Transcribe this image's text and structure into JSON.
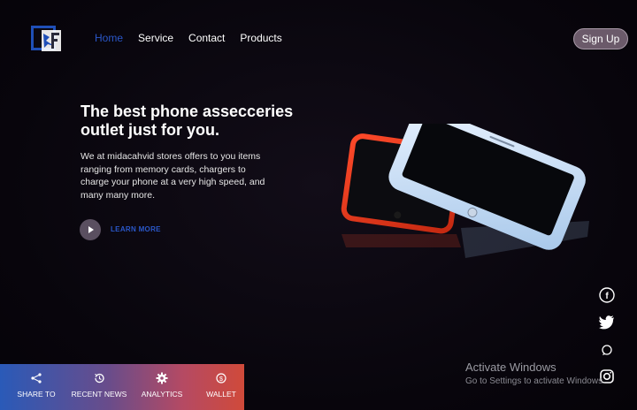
{
  "nav": {
    "items": [
      {
        "label": "Home",
        "active": true
      },
      {
        "label": "Service",
        "active": false
      },
      {
        "label": "Contact",
        "active": false
      },
      {
        "label": "Products",
        "active": false
      }
    ],
    "signup_label": "Sign Up"
  },
  "hero": {
    "title": "The best phone assecceries outlet just for you.",
    "description": "We at midacahvid stores offers to you items ranging from memory cards, chargers to charge your phone at a very high speed, and many many more.",
    "cta_label": "LEARN MORE"
  },
  "social": [
    "facebook-icon",
    "twitter-icon",
    "whatsapp-icon",
    "instagram-icon"
  ],
  "bottom_bar": {
    "items": [
      {
        "label": "SHARE TO",
        "icon": "share-icon"
      },
      {
        "label": "RECENT NEWS",
        "icon": "history-icon"
      },
      {
        "label": "ANALYTICS",
        "icon": "gear-icon"
      },
      {
        "label": "WALLET",
        "icon": "coin-icon"
      }
    ]
  },
  "watermark": {
    "title": "Activate Windows",
    "subtitle": "Go to Settings to activate Windows."
  },
  "colors": {
    "background": "#0a0710",
    "accent_blue": "#2a57c8",
    "signup_bg": "#6b5a6a",
    "bar_gradient_start": "#2a5ab8",
    "bar_gradient_end": "#d04a3a"
  }
}
